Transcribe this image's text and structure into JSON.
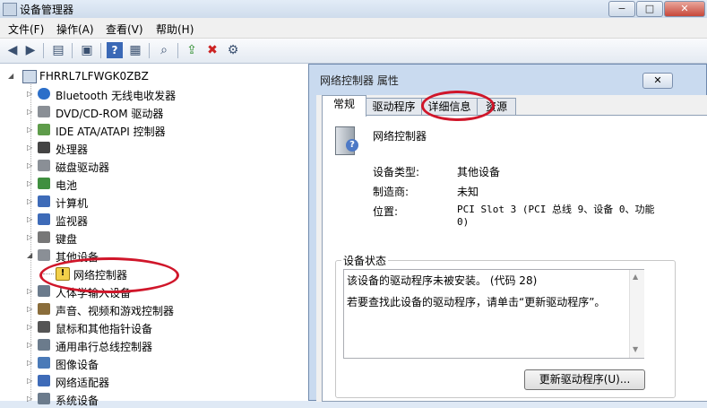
{
  "window": {
    "title": "设备管理器",
    "caption_buttons": [
      "−",
      "□",
      "✕"
    ]
  },
  "menu": [
    "文件(F)",
    "操作(A)",
    "查看(V)",
    "帮助(H)"
  ],
  "toolbar": {
    "icons": [
      "back-icon",
      "forward-icon",
      "properties-icon",
      "help-icon",
      "scan-icon",
      "update-driver-icon",
      "disable-icon",
      "uninstall-icon"
    ]
  },
  "tree": {
    "root": "FHRRL7LFWGK0ZBZ",
    "items": [
      {
        "label": "Bluetooth 无线电收发器",
        "icon": "bluetooth-icon"
      },
      {
        "label": "DVD/CD-ROM 驱动器",
        "icon": "dvd-drive-icon"
      },
      {
        "label": "IDE ATA/ATAPI 控制器",
        "icon": "ide-controller-icon"
      },
      {
        "label": "处理器",
        "icon": "processor-icon"
      },
      {
        "label": "磁盘驱动器",
        "icon": "disk-drive-icon"
      },
      {
        "label": "电池",
        "icon": "battery-icon"
      },
      {
        "label": "计算机",
        "icon": "computer-icon"
      },
      {
        "label": "监视器",
        "icon": "monitor-icon"
      },
      {
        "label": "键盘",
        "icon": "keyboard-icon"
      },
      {
        "label": "其他设备",
        "icon": "other-devices-icon"
      },
      {
        "label": "网络控制器",
        "icon": "warning-device-icon"
      },
      {
        "label": "人体学输入设备",
        "icon": "hid-icon"
      },
      {
        "label": "声音、视频和游戏控制器",
        "icon": "audio-icon"
      },
      {
        "label": "鼠标和其他指针设备",
        "icon": "mouse-icon"
      },
      {
        "label": "通用串行总线控制器",
        "icon": "usb-icon"
      },
      {
        "label": "图像设备",
        "icon": "camera-icon"
      },
      {
        "label": "网络适配器",
        "icon": "network-adapter-icon"
      },
      {
        "label": "系统设备",
        "icon": "system-device-icon"
      }
    ]
  },
  "dialog": {
    "title": "网络控制器 属性",
    "close": "✕",
    "tabs": [
      "常规",
      "驱动程序",
      "详细信息",
      "资源"
    ],
    "device_name": "网络控制器",
    "fields": [
      {
        "label": "设备类型:",
        "value": "其他设备"
      },
      {
        "label": "制造商:",
        "value": "未知"
      },
      {
        "label": "位置:",
        "value": "PCI Slot 3 (PCI 总线 9、设备 0、功能 0)"
      }
    ],
    "status_title": "设备状态",
    "status_line1": "该设备的驱动程序未被安装。 (代码 28)",
    "status_line2": "若要查找此设备的驱动程序，请单击“更新驱动程序”。",
    "update_button": "更新驱动程序(U)..."
  },
  "colors": {
    "annotation": "#d0162a",
    "dialog_frame": "#c9daef",
    "window_bg": "#dfe9f5"
  }
}
